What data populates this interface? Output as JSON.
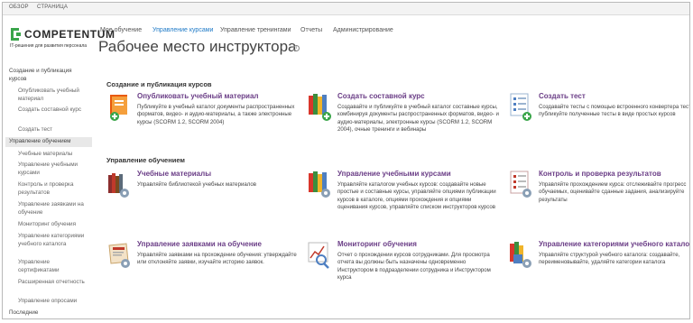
{
  "ribbon": {
    "tabs": [
      "ОБЗОР",
      "СТРАНИЦА"
    ]
  },
  "logo": {
    "name": "COMPETENTUM",
    "tagline": "IT-решения для развития персонала"
  },
  "topnav": {
    "items": [
      "Мое обучение",
      "Управление курсами",
      "Управление тренингами",
      "Отчеты",
      "Администрирование"
    ],
    "active": "Управление курсами"
  },
  "page": {
    "title": "Рабочее место инструктора",
    "info_glyph": "i"
  },
  "sidebar": {
    "items": [
      {
        "label": "Создание и публикация курсов",
        "level": 0
      },
      {
        "label": "Опубликовать учебный материал",
        "level": 1
      },
      {
        "label": "Создать составной курс",
        "level": 1
      },
      {
        "label": "Создать тест",
        "level": 1
      },
      {
        "label": "Управление обучением",
        "level": 0,
        "selected": true
      },
      {
        "label": "Учебные материалы",
        "level": 1
      },
      {
        "label": "Управление учебными курсами",
        "level": 1
      },
      {
        "label": "Контроль и проверка результатов",
        "level": 1
      },
      {
        "label": "Управление заявками на обучение",
        "level": 1
      },
      {
        "label": "Мониторинг обучения",
        "level": 1
      },
      {
        "label": "Управление категориями учебного каталога",
        "level": 1
      },
      {
        "label": "Управление сертификатами",
        "level": 1
      },
      {
        "label": "Расширенная отчетность",
        "level": 1
      },
      {
        "label": "Управление опросами",
        "level": 1
      },
      {
        "label": "Последние",
        "level": 0
      }
    ]
  },
  "sections": [
    {
      "title": "Создание и публикация курсов",
      "cards": [
        {
          "icon": "publish-material-icon",
          "title": "Опубликовать учебный материал",
          "desc": "Публикуйте в учебный каталог документы распространенных форматов, видео- и аудио-материалы, а также электронные курсы (SCORM 1.2, SCORM 2004)"
        },
        {
          "icon": "composite-course-icon",
          "title": "Создать составной курс",
          "desc": "Создавайте и публикуйте в учебный каталог составные курсы, комбинируя документы распространенных форматов, видео- и аудио-материалы, электронные курсы (SCORM 1.2, SCORM 2004), очные тренинги и вебинары"
        },
        {
          "icon": "create-test-icon",
          "title": "Создать тест",
          "desc": "Создавайте тесты с помощью встроенного конвертера тестов и публикуйте полученные тесты в виде простых курсов"
        }
      ]
    },
    {
      "title": "Управление обучением",
      "cards": [
        {
          "icon": "library-books-icon",
          "title": "Учебные материалы",
          "desc": "Управляйте библиотекой учебных материалов"
        },
        {
          "icon": "manage-courses-icon",
          "title": "Управление учебными курсами",
          "desc": "Управляйте каталогом учебных курсов: создавайте новые простые и составные курсы, управляйте опциями публикации курсов в каталоге, опциями прохождения и опциями оценивания курсов, управляйте списком инструкторов курсов"
        },
        {
          "icon": "results-check-icon",
          "title": "Контроль и проверка результатов",
          "desc": "Управляйте прохождением курса: отслеживайте прогресс обучаемых, оценивайте сданные задания, анализируйте результаты"
        },
        {
          "icon": "requests-icon",
          "title": "Управление заявками на обучение",
          "desc": "Управляйте заявками на прохождение обучения: утверждайте или отклоняйте заявки, изучайте историю заявок."
        },
        {
          "icon": "monitoring-icon",
          "title": "Мониторинг обучения",
          "desc": "Отчет о прохождении курсов сотрудниками. Для просмотра отчета вы должны быть назначены одновременно Инструктором в подразделении сотрудника и Инструктором курса"
        },
        {
          "icon": "catalog-categories-icon",
          "title": "Управление категориями учебного каталога",
          "desc": "Управляйте структурой учебного каталога: создавайте, переименовывайте, удаляйте категории каталога"
        }
      ]
    }
  ],
  "colors": {
    "link_title": "#6a3d86",
    "active_nav": "#1f7ac7",
    "logo_green": "#3aa54a"
  }
}
